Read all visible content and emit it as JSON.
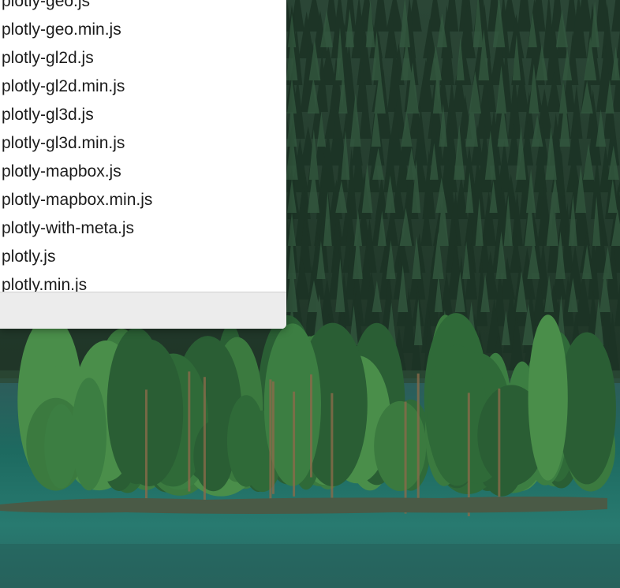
{
  "window": {
    "files": [
      "plotly-geo.js",
      "plotly-geo.min.js",
      "plotly-gl2d.js",
      "plotly-gl2d.min.js",
      "plotly-gl3d.js",
      "plotly-gl3d.min.js",
      "plotly-mapbox.js",
      "plotly-mapbox.min.js",
      "plotly-with-meta.js",
      "plotly.js",
      "plotly.min.js"
    ]
  },
  "desktop": {
    "wallpaper": "forest-island-lake"
  },
  "colors": {
    "forest_dark": "#233a2c",
    "forest_mid": "#2f5a3a",
    "island_green": "#3f7d44",
    "lake_teal": "#2a6b64",
    "window_bg": "#ffffff",
    "status_bar_bg": "#ececec"
  }
}
